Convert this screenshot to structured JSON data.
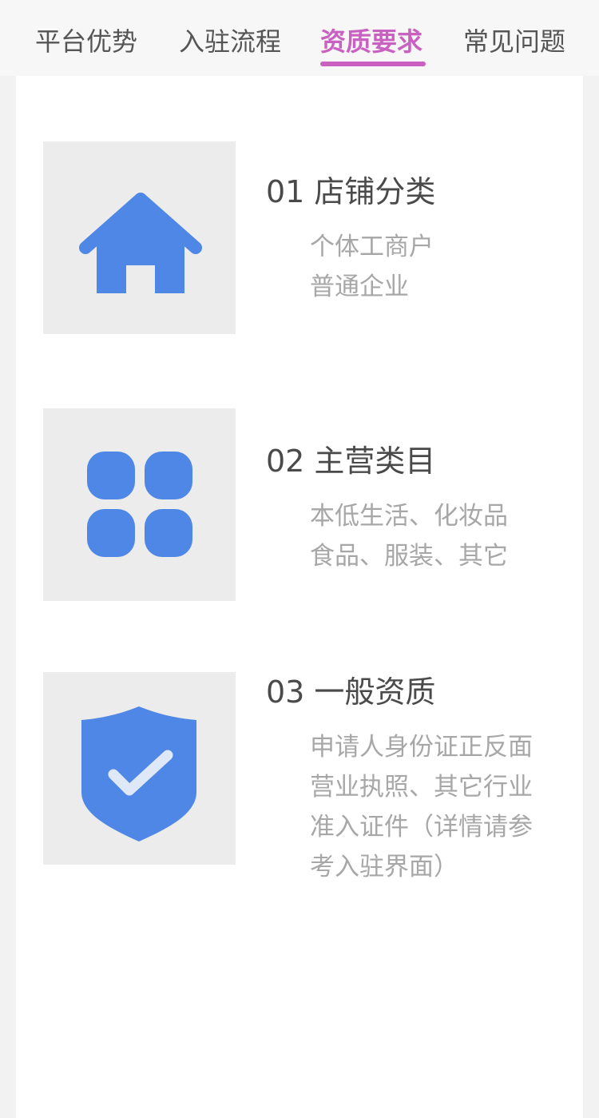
{
  "tabs": [
    {
      "label": "平台优势",
      "active": false
    },
    {
      "label": "入驻流程",
      "active": false
    },
    {
      "label": "资质要求",
      "active": true
    },
    {
      "label": "常见问题",
      "active": false
    }
  ],
  "colors": {
    "accent": "#c961c1",
    "icon_blue": "#4f87e6",
    "icon_bg": "#ececec",
    "title": "#4a4a4a",
    "subtext": "#a7a7a7"
  },
  "sections": [
    {
      "icon": "house-icon",
      "title": "01 店铺分类",
      "lines": [
        "个体工商户",
        "普通企业"
      ]
    },
    {
      "icon": "grid-icon",
      "title": "02 主营类目",
      "lines": [
        "本低生活、化妆品",
        "食品、服装、其它"
      ]
    },
    {
      "icon": "shield-check-icon",
      "title": "03 一般资质",
      "lines": [
        "申请人身份证正反面",
        "营业执照、其它行业",
        "准入证件（详情请参",
        "考入驻界面）"
      ]
    }
  ]
}
